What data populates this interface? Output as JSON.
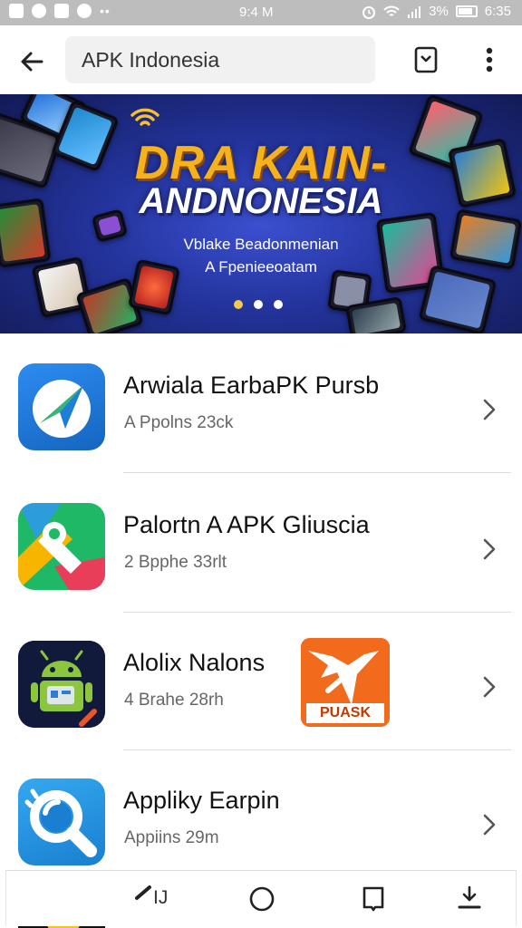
{
  "status_bar": {
    "time": "9:4 M",
    "battery": "3%",
    "clock_right": "6:35",
    "icons": [
      "gmail-icon",
      "messenger-icon",
      "photo-icon",
      "chat-icon",
      "alarm-icon",
      "wifi-icon",
      "signal-icon",
      "battery-icon"
    ]
  },
  "app_bar": {
    "search_text": "APK Indonesia",
    "icons": [
      "back-arrow-icon",
      "bookmark-icon",
      "more-vert-icon"
    ]
  },
  "banner": {
    "title_line1": "DRA KAIN-",
    "title_line2": "ANDNONESIA",
    "subtitle_line1": "Vblake Beadonmenian",
    "subtitle_line2": "A Fpenieeoatam",
    "slide_count": 3,
    "active_slide": 1
  },
  "apps": [
    {
      "title": "Arwiala EarbaPK Pursb",
      "subtitle": "A Ppolns 23ck",
      "icon": "blue-arrow-app-icon"
    },
    {
      "title": "Palortn A APK Gliuscia",
      "subtitle": "2 Bpphe 33rlt",
      "icon": "multicolor-ribbon-app-icon"
    },
    {
      "title": "Alolix Nalons",
      "subtitle": "4 Brahe 28rh",
      "icon": "android-robot-app-icon"
    },
    {
      "title": "Appliky Earpin",
      "subtitle": "Appiins 29m",
      "icon": "magnifier-app-icon"
    }
  ],
  "promo": {
    "label": "PUASK",
    "icon": "orange-promo-icon"
  },
  "bottom_nav": {
    "items": [
      {
        "label": "IJ",
        "icon": "pen-icon"
      },
      {
        "label": "",
        "icon": "home-circle-icon"
      },
      {
        "label": "",
        "icon": "square-icon"
      },
      {
        "label": "",
        "icon": "download-icon"
      }
    ]
  },
  "colors": {
    "banner_bg": "#23339b",
    "title_gold": "#f6b21c",
    "accent_active_dot": "#f2c94c",
    "divider": "#dedede"
  }
}
